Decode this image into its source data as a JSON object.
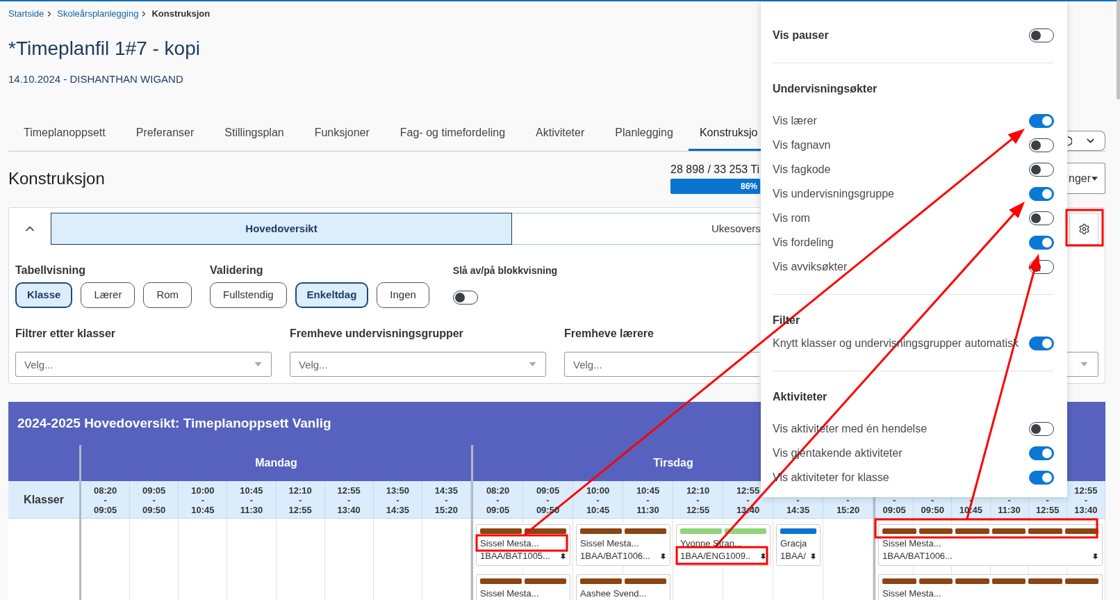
{
  "breadcrumb": [
    {
      "label": "Startside",
      "current": false
    },
    {
      "label": "Skoleårsplanlegging",
      "current": false
    },
    {
      "label": "Konstruksjon",
      "current": true
    }
  ],
  "title": "*Timeplanfil 1#7 - kopi",
  "subtitle": "14.10.2024 - DISHANTHAN WIGAND",
  "tabs": [
    {
      "label": "Timeplanoppsett",
      "selected": false
    },
    {
      "label": "Preferanser",
      "selected": false
    },
    {
      "label": "Stillingsplan",
      "selected": false
    },
    {
      "label": "Funksjoner",
      "selected": false
    },
    {
      "label": "Fag- og timefordeling",
      "selected": false
    },
    {
      "label": "Aktiviteter",
      "selected": false
    },
    {
      "label": "Planlegging",
      "selected": false
    },
    {
      "label": "Konstruksjo",
      "selected": true
    }
  ],
  "section": {
    "heading": "Konstruksjon",
    "progress": {
      "text": "28 898 / 33 253 Ti",
      "level": 0.86,
      "label": "86%"
    },
    "settings_button": {
      "label": "nger"
    }
  },
  "view_tabs": [
    {
      "label": "Hovedoversikt",
      "selected": true
    },
    {
      "label": "Ukesovers",
      "selected": false
    }
  ],
  "option_groups": [
    {
      "label": "Tabellvisning",
      "options": [
        {
          "label": "Klasse",
          "selected": true
        },
        {
          "label": "Lærer",
          "selected": false
        },
        {
          "label": "Rom",
          "selected": false
        }
      ]
    },
    {
      "label": "Validering",
      "options": [
        {
          "label": "Fullstendig",
          "selected": false
        },
        {
          "label": "Enkeltdag",
          "selected": true
        },
        {
          "label": "Ingen",
          "selected": false
        }
      ]
    }
  ],
  "block_view": {
    "label": "Slå av/på blokkvisning",
    "on": false
  },
  "filters": [
    {
      "label": "Filtrer etter klasser",
      "placeholder": "Velg..."
    },
    {
      "label": "Fremheve undervisningsgrupper",
      "placeholder": "Velg..."
    },
    {
      "label": "Fremheve lærere",
      "placeholder": "Velg..."
    }
  ],
  "table": {
    "title": "2024-2025 Hovedoversikt: Timeplanoppsett Vanlig",
    "row_header": "Klasser",
    "days": [
      {
        "name": "Mandag",
        "periods": [
          "08:20\n-\n09:05",
          "09:05\n-\n09:50",
          "10:00\n-\n10:45",
          "10:45\n-\n11:30",
          "12:10\n-\n12:55",
          "12:55\n-\n13:40",
          "13:50\n-\n14:35",
          "14:35\n-\n15:20"
        ]
      },
      {
        "name": "Tirsdag",
        "periods": [
          "08:20\n-\n09:05",
          "09:05\n-\n09:50",
          "10:00\n-\n10:45",
          "10:45\n-\n11:30",
          "12:10\n-\n12:55",
          "12:55\n-\n13:40",
          "-\n14:35",
          "-\n15:20"
        ],
        "rows": [
          [
            {
              "kind": "lesson",
              "bars": [
                {
                  "color": "#8b4513"
                },
                {
                  "color": "#8b4513"
                }
              ],
              "teacher": "Sissel Mesta...",
              "group": "1BAA/BAT1005...",
              "pinned": true
            },
            {
              "kind": "lesson",
              "bars": [
                {
                  "color": "#8b4513"
                },
                {
                  "color": "#8b4513"
                }
              ],
              "teacher": "Sissel Mesta...",
              "group": "1BAA/BAT1006...",
              "pinned": true
            },
            {
              "kind": "lesson",
              "bars": [
                {
                  "color": "#90d47a"
                },
                {
                  "color": "#90d47a"
                }
              ],
              "teacher": "Yvonne Stran...",
              "group": "1BAA/ENG1009..",
              "pinned": true
            },
            {
              "kind": "lesson",
              "bars": [
                {
                  "color": "#0b75d1"
                }
              ],
              "teacher": "Gracja",
              "group": "1BAA/",
              "pinned": true
            },
            {
              "kind": "empty"
            }
          ],
          [
            {
              "kind": "lesson",
              "bars": [
                {
                  "color": "#8b4513"
                },
                {
                  "color": "#8b4513"
                }
              ],
              "teacher": "Sissel Mesta..."
            },
            {
              "kind": "lesson",
              "bars": [
                {
                  "color": "#8b4513"
                },
                {
                  "color": "#8b4513"
                }
              ],
              "teacher": "Aashee Svend..."
            }
          ]
        ]
      },
      {
        "periods": [
          "-\n09:05",
          "-\n09:50",
          "-\n10:45",
          "-\n11:30",
          "-\n12:55",
          "12:55\n-\n13:40"
        ],
        "rows": [
          [
            {
              "kind": "lesson",
              "bars": [
                {
                  "color": "#8b4513"
                },
                {
                  "color": "#8b4513"
                },
                {
                  "color": "#8b4513"
                },
                {
                  "color": "#8b4513"
                },
                {
                  "color": "#8b4513"
                },
                {
                  "color": "#8b4513"
                }
              ],
              "teacher": "Sissel Mesta...",
              "group": "1BAA/BAT1006...",
              "pinned": true
            }
          ],
          [
            {
              "kind": "lesson",
              "bars": [
                {
                  "color": "#8b4513"
                },
                {
                  "color": "#8b4513"
                },
                {
                  "color": "#8b4513"
                },
                {
                  "color": "#8b4513"
                },
                {
                  "color": "#8b4513"
                },
                {
                  "color": "#8b4513"
                }
              ],
              "teacher": "Sissel Mesta..."
            }
          ]
        ]
      }
    ]
  },
  "settings_panel": {
    "pause_toggle": {
      "label": "Vis pauser",
      "on": false
    },
    "sections": [
      {
        "heading": "Undervisningsøkter",
        "items": [
          {
            "label": "Vis lærer",
            "on": true
          },
          {
            "label": "Vis fagnavn",
            "on": false
          },
          {
            "label": "Vis fagkode",
            "on": false
          },
          {
            "label": "Vis undervisningsgruppe",
            "on": true
          },
          {
            "label": "Vis rom",
            "on": false
          },
          {
            "label": "Vis fordeling",
            "on": true
          },
          {
            "label": "Vis avviksøkter",
            "on": false
          }
        ]
      },
      {
        "heading": "Filter",
        "items": [
          {
            "label": "Knytt klasser og undervisningsgrupper automatisk",
            "on": true
          }
        ]
      },
      {
        "heading": "Aktiviteter",
        "items": [
          {
            "label": "Vis aktiviteter med én hendelse",
            "on": false
          },
          {
            "label": "Vis gjentakende aktiviteter",
            "on": true
          },
          {
            "label": "Vis aktiviteter for klasse",
            "on": true
          }
        ]
      }
    ]
  }
}
